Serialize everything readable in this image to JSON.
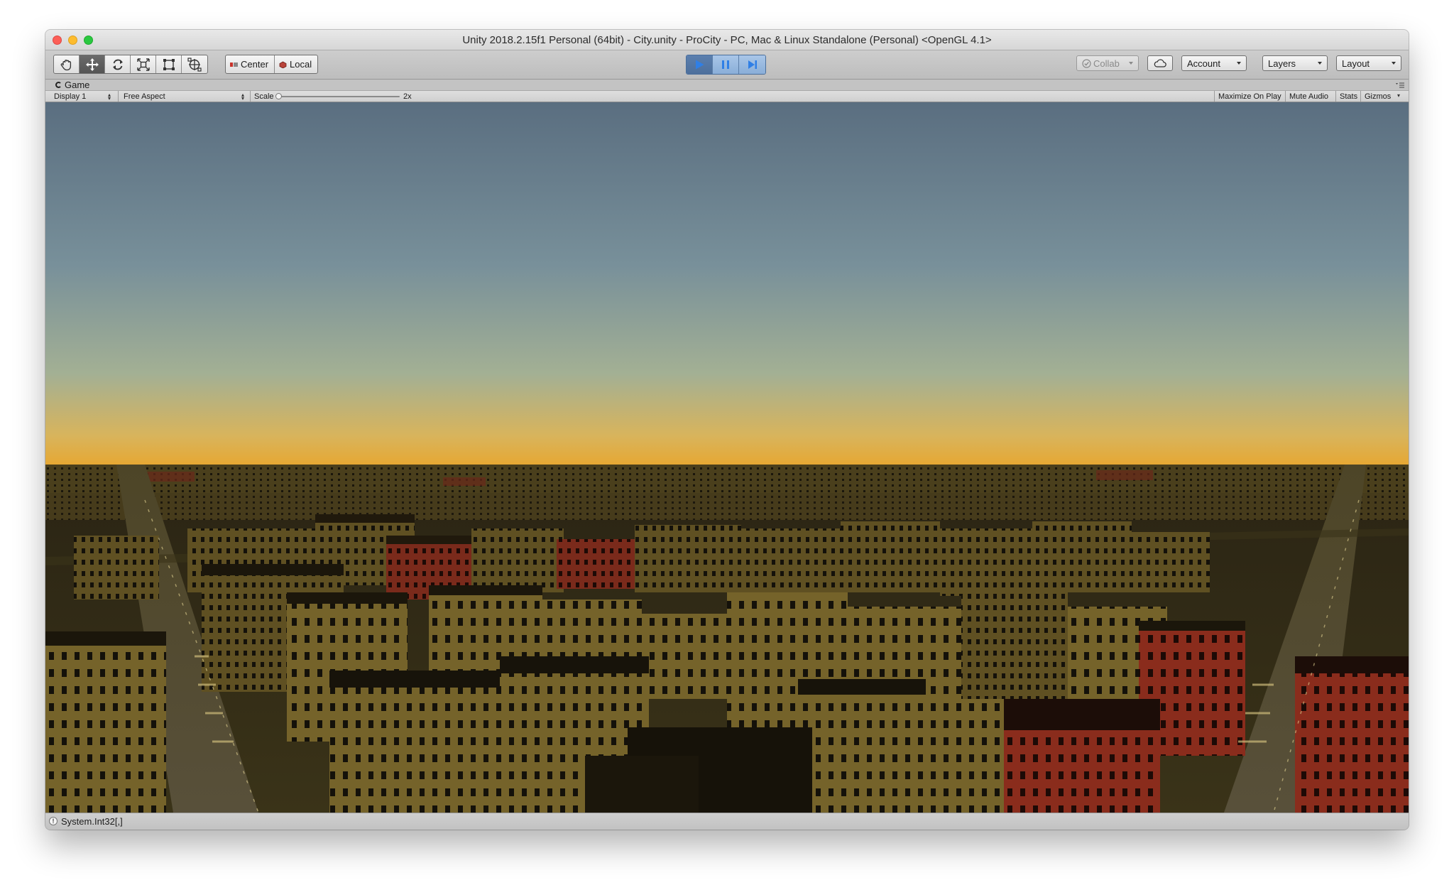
{
  "window": {
    "title": "Unity 2018.2.15f1 Personal (64bit) - City.unity - ProCity - PC, Mac & Linux Standalone (Personal) <OpenGL 4.1>"
  },
  "toolbar": {
    "transform_tools": [
      "hand-tool",
      "move-tool",
      "rotate-tool",
      "scale-tool",
      "rect-tool",
      "transform-tool"
    ],
    "active_tool": "move-tool",
    "pivot_label": "Center",
    "pivot_rotation_label": "Local",
    "collab_label": "Collab",
    "account_label": "Account",
    "layers_label": "Layers",
    "layout_label": "Layout",
    "play_state": "playing"
  },
  "game_view": {
    "tab_label": "Game",
    "display_label": "Display 1",
    "aspect_label": "Free Aspect",
    "scale_label": "Scale",
    "scale_value": "2x",
    "maximize_label": "Maximize On Play",
    "mute_label": "Mute Audio",
    "stats_label": "Stats",
    "gizmos_label": "Gizmos"
  },
  "status": {
    "message": "System.Int32[,]"
  },
  "colors": {
    "sky_top": "#5a6e80",
    "sky_horizon": "#e6ad3a",
    "building_yellow": "#6b5a24",
    "building_red": "#8a2c1c",
    "play_blue": "#2f7fe6"
  }
}
